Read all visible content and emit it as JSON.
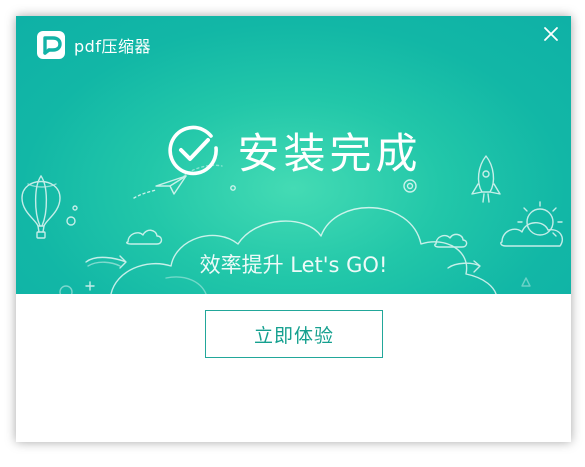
{
  "app": {
    "name": "pdf压缩器",
    "logo_icon": "pdf-app-logo-icon",
    "close_icon": "close-icon"
  },
  "banner": {
    "status_icon": "check-circle-icon",
    "title": "安装完成",
    "subtitle": "效率提升 Let's  GO!"
  },
  "action": {
    "primary_label": "立即体验"
  },
  "colors": {
    "accent": "#13b3a7",
    "accent_light": "#44dbb4",
    "button_border": "#22a79a",
    "button_text": "#15a08f"
  }
}
